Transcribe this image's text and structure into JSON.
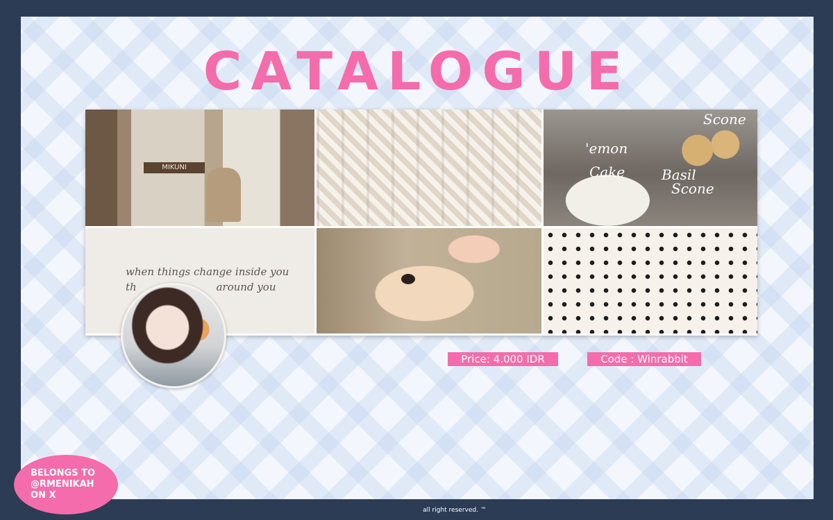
{
  "title": "CATALOGUE",
  "tiles": {
    "cafe_sign": "MIKUNI",
    "quote_line1": "when things change inside you",
    "quote_line2": "th",
    "quote_line3": "around you",
    "cake_words": [
      "Scone",
      "'emon",
      "Cake",
      "Basil",
      "Scone"
    ]
  },
  "price_label": "Price: 4.000 IDR",
  "code_label": "Code : Winrabbit",
  "belongs": [
    "BELONGS TO",
    "@RMENIKAH",
    "ON X"
  ],
  "footer": "all right reserved. ™",
  "colors": {
    "accent": "#f46cab",
    "border": "#2c3c55",
    "background": "#f3f7fd"
  }
}
